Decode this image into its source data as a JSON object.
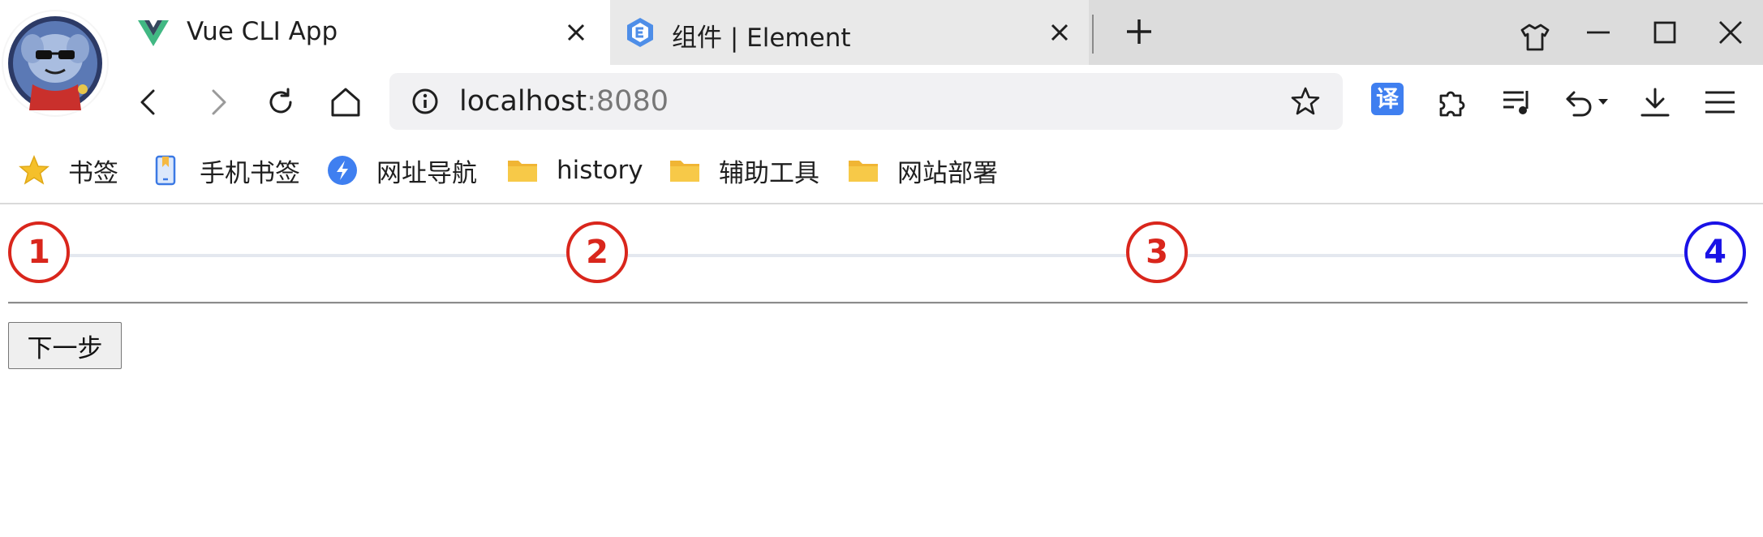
{
  "browser": {
    "tabs": [
      {
        "title": "Vue CLI App",
        "active": true,
        "favicon": "vue-logo-icon"
      },
      {
        "title": "组件 | Element",
        "active": false,
        "favicon": "element-logo-icon"
      }
    ],
    "address_bar": {
      "host": "localhost",
      "port": ":8080"
    },
    "toolbar_icons": [
      "back-icon",
      "forward-icon",
      "reload-icon",
      "home-icon",
      "info-icon",
      "bookmark-star-icon",
      "translate-icon",
      "extensions-icon",
      "media-icon",
      "undo-icon",
      "download-icon",
      "menu-icon"
    ],
    "translate_badge": "译",
    "bookmarks": [
      {
        "label": "书签",
        "icon": "star-icon"
      },
      {
        "label": "手机书签",
        "icon": "phone-bookmark-icon"
      },
      {
        "label": "网址导航",
        "icon": "nav-logo-icon"
      },
      {
        "label": "history",
        "icon": "folder-icon"
      },
      {
        "label": "辅助工具",
        "icon": "folder-icon"
      },
      {
        "label": "网站部署",
        "icon": "folder-icon"
      }
    ]
  },
  "page": {
    "steps": [
      {
        "label": "1",
        "state": "done"
      },
      {
        "label": "2",
        "state": "done"
      },
      {
        "label": "3",
        "state": "done"
      },
      {
        "label": "4",
        "state": "current"
      }
    ],
    "next_button": "下一步"
  },
  "colors": {
    "step_done": "#d9261c",
    "step_current": "#1a12e6",
    "step_line": "#e4e8ef"
  }
}
